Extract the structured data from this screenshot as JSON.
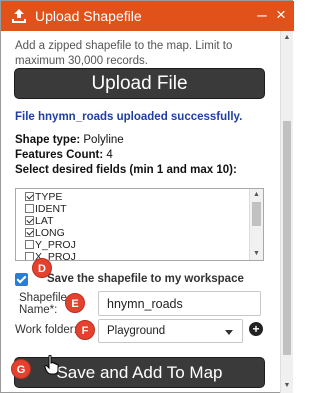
{
  "window": {
    "title": "Upload Shapefile",
    "minimize_label": "–",
    "close_label": "×",
    "title_color": "#e0521a"
  },
  "intro_text": "Add a zipped shapefile to the map. Limit to maximum 30,000 records.",
  "upload_button_label": "Upload File",
  "success_message": "File hnymn_roads uploaded successfully.",
  "shape_info": {
    "shape_type_label": "Shape type:",
    "shape_type_value": "Polyline",
    "features_count_label": "Features Count:",
    "features_count_value": "4",
    "select_fields_label": "Select desired fields (min 1 and max 10):"
  },
  "fields": [
    {
      "name": "TYPE",
      "checked": true
    },
    {
      "name": "IDENT",
      "checked": false
    },
    {
      "name": "LAT",
      "checked": true
    },
    {
      "name": "LONG",
      "checked": true
    },
    {
      "name": "Y_PROJ",
      "checked": false
    },
    {
      "name": "X_PROJ",
      "checked": false
    }
  ],
  "save_to_workspace": {
    "checked": true,
    "label": "Save the shapefile to my workspace"
  },
  "shapefile_name": {
    "label_line1": "Shapefile",
    "label_line2": "Name*:",
    "value": "hnymn_roads"
  },
  "work_folder": {
    "label": "Work folder:",
    "selected": "Playground",
    "add_label": "+"
  },
  "add_to_map_button_label": "Save and Add To Map",
  "step_badges": {
    "d": "D",
    "e": "E",
    "f": "F",
    "g": "G"
  },
  "scroll_arrows": {
    "up": "▲",
    "down": "▼"
  },
  "colors": {
    "accent": "#e0521a",
    "success_text": "#1f3fa0",
    "checkbox": "#2a7fd4",
    "badge": "#e5412f",
    "button": "#3a3a3a"
  }
}
